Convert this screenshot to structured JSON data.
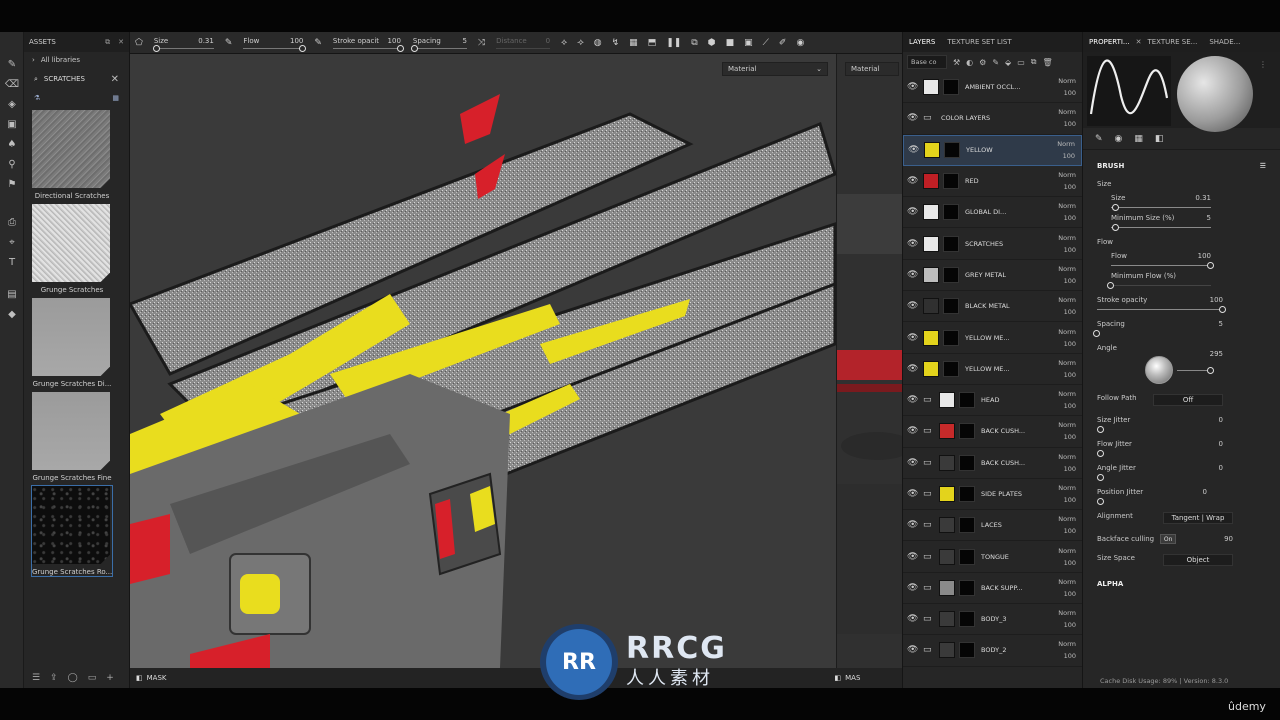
{
  "toolbar": {
    "size_label": "Size",
    "size_value": "0.31",
    "size_knob_fraction": 0.05,
    "flow_label": "Flow",
    "flow_value": "100",
    "flow_knob_fraction": 1.0,
    "opacity_label": "Stroke opacit",
    "opacity_value": "100",
    "opacity_knob_fraction": 1.0,
    "spacing_label": "Spacing",
    "spacing_value": "5",
    "spacing_knob_fraction": 0.03,
    "distance_label": "Distance",
    "distance_value": "0"
  },
  "assets": {
    "title": "ASSETS",
    "library": "All libraries",
    "search": "SCRATCHES",
    "items": [
      {
        "label": "Directional Scratches",
        "style": "normal"
      },
      {
        "label": "Grunge Scratches",
        "style": "light"
      },
      {
        "label": "Grunge Scratches Di...",
        "style": "mid"
      },
      {
        "label": "Grunge Scratches Fine",
        "style": "mid"
      },
      {
        "label": "Grunge Scratches Ro...",
        "style": "dark"
      }
    ]
  },
  "viewport": {
    "select_left": "Material",
    "select_right": "Material",
    "mask_label": "MASK",
    "mask_label_right": "MAS"
  },
  "layers": {
    "tabs": [
      "LAYERS",
      "TEXTURE SET LIST"
    ],
    "blend_select": "Base co",
    "rows": [
      {
        "name": "AMBIENT OCCL...",
        "blend": "Norm",
        "opacity": "100",
        "color": "#e8e8e8",
        "type": "fill"
      },
      {
        "name": "COLOR LAYERS",
        "blend": "Norm",
        "opacity": "100",
        "color": "",
        "type": "folder"
      },
      {
        "name": "YELLOW",
        "blend": "Norm",
        "opacity": "100",
        "color": "#e3d31c",
        "type": "fill"
      },
      {
        "name": "RED",
        "blend": "Norm",
        "opacity": "100",
        "color": "#c01f25",
        "type": "fill"
      },
      {
        "name": "GLOBAL DI...",
        "blend": "Norm",
        "opacity": "100",
        "color": "#e8e8e8",
        "type": "fill"
      },
      {
        "name": "SCRATCHES",
        "blend": "Norm",
        "opacity": "100",
        "color": "#e8e8e8",
        "type": "fill"
      },
      {
        "name": "GREY METAL",
        "blend": "Norm",
        "opacity": "100",
        "color": "#bdbdbd",
        "type": "fill"
      },
      {
        "name": "BLACK METAL",
        "blend": "Norm",
        "opacity": "100",
        "color": "#303030",
        "type": "fill"
      },
      {
        "name": "YELLOW ME...",
        "blend": "Norm",
        "opacity": "100",
        "color": "#e3d31c",
        "type": "fill"
      },
      {
        "name": "YELLOW ME...",
        "blend": "Norm",
        "opacity": "100",
        "color": "#e3d31c",
        "type": "fill"
      },
      {
        "name": "HEAD",
        "blend": "Norm",
        "opacity": "100",
        "color": "#e8e8e8",
        "type": "folder"
      },
      {
        "name": "BACK CUSH...",
        "blend": "Norm",
        "opacity": "100",
        "color": "#c72a2a",
        "type": "folder"
      },
      {
        "name": "BACK CUSH...",
        "blend": "Norm",
        "opacity": "100",
        "color": "#3a3a3a",
        "type": "folder"
      },
      {
        "name": "SIDE PLATES",
        "blend": "Norm",
        "opacity": "100",
        "color": "#e3d31c",
        "type": "folder"
      },
      {
        "name": "LACES",
        "blend": "Norm",
        "opacity": "100",
        "color": "#3a3a3a",
        "type": "folder"
      },
      {
        "name": "TONGUE",
        "blend": "Norm",
        "opacity": "100",
        "color": "#3a3a3a",
        "type": "folder"
      },
      {
        "name": "BACK SUPP...",
        "blend": "Norm",
        "opacity": "100",
        "color": "#8a8a8a",
        "type": "folder"
      },
      {
        "name": "BODY_3",
        "blend": "Norm",
        "opacity": "100",
        "color": "#3a3a3a",
        "type": "folder"
      },
      {
        "name": "BODY_2",
        "blend": "Norm",
        "opacity": "100",
        "color": "#3a3a3a",
        "type": "folder"
      }
    ]
  },
  "properties": {
    "tabs": [
      "PROPERTI...",
      "TEXTURE SE...",
      "SHADE..."
    ],
    "brush_title": "BRUSH",
    "size_section": "Size",
    "size_label": "Size",
    "size_value": "0.31",
    "size_fraction": 0.05,
    "min_size_label": "Minimum Size (%)",
    "min_size_value": "5",
    "min_size_fraction": 0.05,
    "flow_section": "Flow",
    "flow_label": "Flow",
    "flow_value": "100",
    "flow_fraction": 1.0,
    "min_flow_label": "Minimum Flow (%)",
    "min_flow_value": "",
    "min_flow_fraction": 0.0,
    "opacity_label": "Stroke opacity",
    "opacity_value": "100",
    "opacity_fraction": 1.0,
    "spacing_label": "Spacing",
    "spacing_value": "5",
    "spacing_fraction": 0.0,
    "angle_label": "Angle",
    "angle_value": "295",
    "follow_path_label": "Follow Path",
    "follow_path_value": "Off",
    "size_jitter_label": "Size Jitter",
    "size_jitter_value": "0",
    "flow_jitter_label": "Flow Jitter",
    "flow_jitter_value": "0",
    "angle_jitter_label": "Angle Jitter",
    "angle_jitter_value": "0",
    "position_jitter_label": "Position Jitter",
    "position_jitter_value": "0",
    "alignment_label": "Alignment",
    "alignment_value": "Tangent | Wrap",
    "backface_label": "Backface culling",
    "backface_toggle": "On",
    "backface_value": "90",
    "size_space_label": "Size Space",
    "size_space_value": "Object",
    "alpha_title": "ALPHA"
  },
  "status": {
    "cache": "Cache Disk Usage:",
    "cache_value": "89%",
    "version": "Version: 8.3.0"
  },
  "watermark": {
    "main": "RRCG",
    "sub": "人人素材"
  },
  "brand": "ûdemy"
}
